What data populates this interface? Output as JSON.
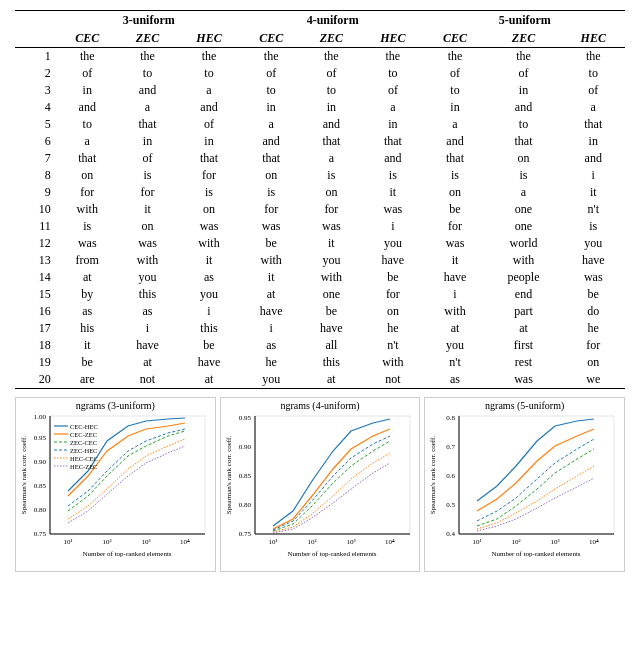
{
  "table": {
    "headers": {
      "groups": [
        "3-uniform",
        "4-uniform",
        "5-uniform"
      ],
      "subheaders": [
        "CEC",
        "ZEC",
        "HEC",
        "CEC",
        "ZEC",
        "HEC",
        "CEC",
        "ZEC",
        "HEC"
      ]
    },
    "rows": [
      {
        "rank": 1,
        "c1": "the",
        "c2": "the",
        "c3": "the",
        "c4": "the",
        "c5": "the",
        "c6": "the",
        "c7": "the",
        "c8": "the",
        "c9": "the"
      },
      {
        "rank": 2,
        "c1": "of",
        "c2": "to",
        "c3": "to",
        "c4": "of",
        "c5": "of",
        "c6": "to",
        "c7": "of",
        "c8": "of",
        "c9": "to"
      },
      {
        "rank": 3,
        "c1": "in",
        "c2": "and",
        "c3": "a",
        "c4": "to",
        "c5": "to",
        "c6": "of",
        "c7": "to",
        "c8": "in",
        "c9": "of"
      },
      {
        "rank": 4,
        "c1": "and",
        "c2": "a",
        "c3": "and",
        "c4": "in",
        "c5": "in",
        "c6": "a",
        "c7": "in",
        "c8": "and",
        "c9": "a"
      },
      {
        "rank": 5,
        "c1": "to",
        "c2": "that",
        "c3": "of",
        "c4": "a",
        "c5": "and",
        "c6": "in",
        "c7": "a",
        "c8": "to",
        "c9": "that"
      },
      {
        "rank": 6,
        "c1": "a",
        "c2": "in",
        "c3": "in",
        "c4": "and",
        "c5": "that",
        "c6": "that",
        "c7": "and",
        "c8": "that",
        "c9": "in"
      },
      {
        "rank": 7,
        "c1": "that",
        "c2": "of",
        "c3": "that",
        "c4": "that",
        "c5": "a",
        "c6": "and",
        "c7": "that",
        "c8": "on",
        "c9": "and"
      },
      {
        "rank": 8,
        "c1": "on",
        "c2": "is",
        "c3": "for",
        "c4": "on",
        "c5": "is",
        "c6": "is",
        "c7": "is",
        "c8": "is",
        "c9": "i"
      },
      {
        "rank": 9,
        "c1": "for",
        "c2": "for",
        "c3": "is",
        "c4": "is",
        "c5": "on",
        "c6": "it",
        "c7": "on",
        "c8": "a",
        "c9": "it"
      },
      {
        "rank": 10,
        "c1": "with",
        "c2": "it",
        "c3": "on",
        "c4": "for",
        "c5": "for",
        "c6": "was",
        "c7": "be",
        "c8": "one",
        "c9": "n't"
      },
      {
        "rank": 11,
        "c1": "is",
        "c2": "on",
        "c3": "was",
        "c4": "was",
        "c5": "was",
        "c6": "i",
        "c7": "for",
        "c8": "one",
        "c9": "is"
      },
      {
        "rank": 12,
        "c1": "was",
        "c2": "was",
        "c3": "with",
        "c4": "be",
        "c5": "it",
        "c6": "you",
        "c7": "was",
        "c8": "world",
        "c9": "you"
      },
      {
        "rank": 13,
        "c1": "from",
        "c2": "with",
        "c3": "it",
        "c4": "with",
        "c5": "you",
        "c6": "have",
        "c7": "it",
        "c8": "with",
        "c9": "have"
      },
      {
        "rank": 14,
        "c1": "at",
        "c2": "you",
        "c3": "as",
        "c4": "it",
        "c5": "with",
        "c6": "be",
        "c7": "have",
        "c8": "people",
        "c9": "was"
      },
      {
        "rank": 15,
        "c1": "by",
        "c2": "this",
        "c3": "you",
        "c4": "at",
        "c5": "one",
        "c6": "for",
        "c7": "i",
        "c8": "end",
        "c9": "be"
      },
      {
        "rank": 16,
        "c1": "as",
        "c2": "as",
        "c3": "i",
        "c4": "have",
        "c5": "be",
        "c6": "on",
        "c7": "with",
        "c8": "part",
        "c9": "do"
      },
      {
        "rank": 17,
        "c1": "his",
        "c2": "i",
        "c3": "this",
        "c4": "i",
        "c5": "have",
        "c6": "he",
        "c7": "at",
        "c8": "at",
        "c9": "he"
      },
      {
        "rank": 18,
        "c1": "it",
        "c2": "have",
        "c3": "be",
        "c4": "as",
        "c5": "all",
        "c6": "n't",
        "c7": "you",
        "c8": "first",
        "c9": "for"
      },
      {
        "rank": 19,
        "c1": "be",
        "c2": "at",
        "c3": "have",
        "c4": "he",
        "c5": "this",
        "c6": "with",
        "c7": "n't",
        "c8": "rest",
        "c9": "on"
      },
      {
        "rank": 20,
        "c1": "are",
        "c2": "not",
        "c3": "at",
        "c4": "you",
        "c5": "at",
        "c6": "not",
        "c7": "as",
        "c8": "was",
        "c9": "we"
      }
    ]
  },
  "charts": [
    {
      "title": "ngrams (3-uniform)",
      "y_label": "Spearman's rank corr. coeff.",
      "x_label": "Number of top-ranked elements",
      "y_range": [
        0.75,
        1.0
      ],
      "y_ticks": [
        "0.75",
        "0.80",
        "0.85",
        "0.90",
        "0.95",
        "1.00"
      ],
      "x_ticks": [
        "10¹",
        "10²",
        "10³",
        "10⁴"
      ],
      "legend": [
        {
          "label": "CEC-HEC",
          "color": "#1f77b4",
          "style": "solid"
        },
        {
          "label": "CEC-ZEC",
          "color": "#ff7f0e",
          "style": "solid"
        },
        {
          "label": "ZEC-CEC",
          "color": "#2ca02c",
          "style": "dashed"
        },
        {
          "label": "ZEC-HEC",
          "color": "#1f77b4",
          "style": "dashed"
        },
        {
          "label": "HEC-CEC",
          "color": "#ff7f0e",
          "style": "dotted"
        },
        {
          "label": "HEC-ZEC",
          "color": "#9467bd",
          "style": "dotted"
        }
      ]
    },
    {
      "title": "ngrams (4-uniform)",
      "y_label": "Spearman's rank corr. coeff.",
      "x_label": "Number of top-ranked elements",
      "y_range": [
        0.75,
        0.95
      ],
      "y_ticks": [
        "0.75",
        "0.80",
        "0.85",
        "0.90",
        "0.95"
      ],
      "x_ticks": [
        "10¹",
        "10²",
        "10³",
        "10⁴"
      ]
    },
    {
      "title": "ngrams (5-uniform)",
      "y_label": "Spearman's rank corr. coeff.",
      "x_label": "Number of top-ranked elements",
      "y_range": [
        0.4,
        0.8
      ],
      "y_ticks": [
        "0.4",
        "0.5",
        "0.6",
        "0.7",
        "0.8"
      ],
      "x_ticks": [
        "10¹",
        "10²",
        "10³",
        "10⁴"
      ]
    }
  ]
}
